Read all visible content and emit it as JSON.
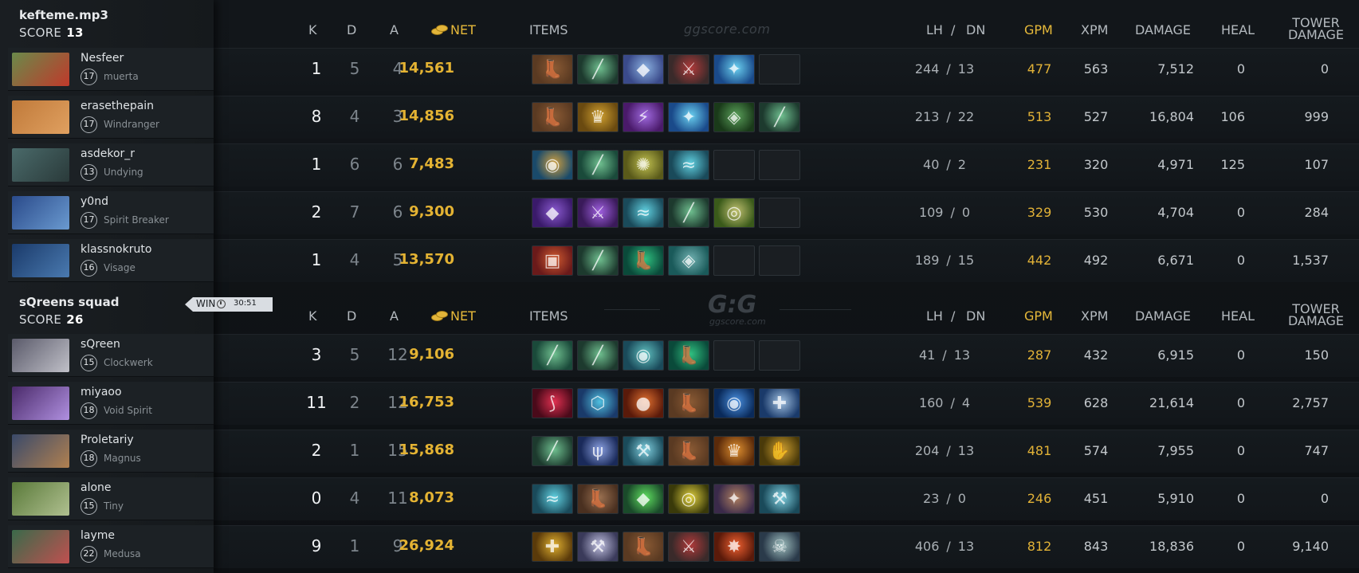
{
  "site": {
    "watermark": "ggscore.com",
    "logo": "G:G",
    "logo_sub": "ggscore.com"
  },
  "headers": {
    "k": "K",
    "d": "D",
    "a": "A",
    "net": "NET",
    "items": "ITEMS",
    "lh": "LH",
    "slash": "/",
    "dn": "DN",
    "gpm": "GPM",
    "xpm": "XPM",
    "damage": "DAMAGE",
    "heal": "HEAL",
    "tower_line1": "TOWER",
    "tower_line2": "DAMAGE"
  },
  "colors": {
    "gold": "#e4b333",
    "win_tag_bg": "#d9dde2"
  },
  "result": {
    "label": "WIN",
    "time": "30:51",
    "clock_icon": "clock-icon"
  },
  "teams": [
    {
      "name": "kefteme.mp3",
      "score_label": "SCORE",
      "score": "13",
      "players": [
        {
          "name": "Nesfeer",
          "level": "17",
          "hero": "muerta",
          "k": "1",
          "d": "5",
          "a": "4",
          "net": "14,561",
          "lh": "244",
          "dn": "13",
          "gpm": "477",
          "xpm": "563",
          "damage": "7,512",
          "heal": "0",
          "tower": "0",
          "portrait_colors": [
            "#6a8a4a",
            "#c0392b"
          ],
          "items": [
            {
              "name": "boots-icon",
              "c1": "#5a3a22",
              "c2": "#8a5a34",
              "g": "👢"
            },
            {
              "name": "staff-icon",
              "c1": "#1d3a2e",
              "c2": "#6fbf8f",
              "g": "╱"
            },
            {
              "name": "mask-icon",
              "c1": "#3a4a8a",
              "c2": "#8ab0e0",
              "g": "◆"
            },
            {
              "name": "axe-icon",
              "c1": "#3a2a2a",
              "c2": "#b03a3a",
              "g": "⚔"
            },
            {
              "name": "orb-icon",
              "c1": "#1a4a8a",
              "c2": "#6ad0f0",
              "g": "✦"
            },
            {
              "name": "empty-slot",
              "empty": true
            }
          ]
        },
        {
          "name": "erasethepain",
          "level": "17",
          "hero": "Windranger",
          "k": "8",
          "d": "4",
          "a": "3",
          "net": "14,856",
          "lh": "213",
          "dn": "22",
          "gpm": "513",
          "xpm": "527",
          "damage": "16,804",
          "heal": "106",
          "tower": "999",
          "portrait_colors": [
            "#c07a3a",
            "#e0a060"
          ],
          "items": [
            {
              "name": "boots-icon",
              "c1": "#5a3a22",
              "c2": "#8a5a34",
              "g": "👢"
            },
            {
              "name": "helm-icon",
              "c1": "#6a4a10",
              "c2": "#d0a030",
              "g": "♛"
            },
            {
              "name": "blade-icon",
              "c1": "#4a1a6a",
              "c2": "#a06ae0",
              "g": "⚡"
            },
            {
              "name": "orb-icon",
              "c1": "#1a4a8a",
              "c2": "#6ad0f0",
              "g": "✦"
            },
            {
              "name": "cloak-icon",
              "c1": "#1a3a1a",
              "c2": "#5aa05a",
              "g": "◈"
            },
            {
              "name": "staff-icon",
              "c1": "#1d3a2e",
              "c2": "#6fbf8f",
              "g": "╱"
            }
          ]
        },
        {
          "name": "asdekor_r",
          "level": "13",
          "hero": "Undying",
          "k": "1",
          "d": "6",
          "a": "6",
          "net": "7,483",
          "lh": "40",
          "dn": "2",
          "gpm": "231",
          "xpm": "320",
          "damage": "4,971",
          "heal": "125",
          "tower": "107",
          "portrait_colors": [
            "#4a6a6a",
            "#2a3a3a"
          ],
          "items": [
            {
              "name": "vessel-icon",
              "c1": "#1a4a6a",
              "c2": "#d0a040",
              "g": "◉"
            },
            {
              "name": "wand-icon",
              "c1": "#1a4a3a",
              "c2": "#70c090",
              "g": "╱"
            },
            {
              "name": "gem-icon",
              "c1": "#5a5a1a",
              "c2": "#c0c050",
              "g": "✺"
            },
            {
              "name": "wind-icon",
              "c1": "#1a4a5a",
              "c2": "#60d0e0",
              "g": "≈"
            },
            {
              "name": "empty-slot",
              "empty": true
            },
            {
              "name": "empty-slot",
              "empty": true
            }
          ]
        },
        {
          "name": "y0nd",
          "level": "17",
          "hero": "Spirit Breaker",
          "k": "2",
          "d": "7",
          "a": "6",
          "net": "9,300",
          "lh": "109",
          "dn": "0",
          "gpm": "329",
          "xpm": "530",
          "damage": "4,704",
          "heal": "0",
          "tower": "284",
          "portrait_colors": [
            "#2a4a8a",
            "#6a9ad0"
          ],
          "items": [
            {
              "name": "cape-icon",
              "c1": "#3a1a6a",
              "c2": "#8a5ad0",
              "g": "◆"
            },
            {
              "name": "sword-icon",
              "c1": "#3a1a5a",
              "c2": "#a060e0",
              "g": "⚔"
            },
            {
              "name": "wind-icon",
              "c1": "#1a4a5a",
              "c2": "#60d0e0",
              "g": "≈"
            },
            {
              "name": "staff-icon",
              "c1": "#1d3a2e",
              "c2": "#6fbf8f",
              "g": "╱"
            },
            {
              "name": "shield-icon",
              "c1": "#3a5a1a",
              "c2": "#c0c070",
              "g": "◎"
            },
            {
              "name": "empty-slot",
              "empty": true
            }
          ]
        },
        {
          "name": "klassnokruto",
          "level": "16",
          "hero": "Visage",
          "k": "1",
          "d": "4",
          "a": "5",
          "net": "13,570",
          "lh": "189",
          "dn": "15",
          "gpm": "442",
          "xpm": "492",
          "damage": "6,671",
          "heal": "0",
          "tower": "1,537",
          "portrait_colors": [
            "#1a3a6a",
            "#4a7ab0"
          ],
          "items": [
            {
              "name": "armor-icon",
              "c1": "#6a1a1a",
              "c2": "#d05a30",
              "g": "▣"
            },
            {
              "name": "staff-icon",
              "c1": "#1d3a2e",
              "c2": "#6fbf8f",
              "g": "╱"
            },
            {
              "name": "boots-green-icon",
              "c1": "#0a4a3a",
              "c2": "#30c080",
              "g": "👢"
            },
            {
              "name": "robe-icon",
              "c1": "#1a5a5a",
              "c2": "#70b0b0",
              "g": "◈"
            },
            {
              "name": "empty-slot",
              "empty": true
            },
            {
              "name": "empty-slot",
              "empty": true
            }
          ]
        }
      ]
    },
    {
      "name": "sQreens squad",
      "score_label": "SCORE",
      "score": "26",
      "players": [
        {
          "name": "sQreen",
          "level": "15",
          "hero": "Clockwerk",
          "k": "3",
          "d": "5",
          "a": "12",
          "net": "9,106",
          "lh": "41",
          "dn": "13",
          "gpm": "287",
          "xpm": "432",
          "damage": "6,915",
          "heal": "0",
          "tower": "150",
          "portrait_colors": [
            "#5a5a6a",
            "#c0c0c8"
          ],
          "items": [
            {
              "name": "wand-icon",
              "c1": "#1a4a3a",
              "c2": "#70c090",
              "g": "╱"
            },
            {
              "name": "staff-icon",
              "c1": "#1d3a2e",
              "c2": "#6fbf8f",
              "g": "╱"
            },
            {
              "name": "eye-icon",
              "c1": "#1a4a5a",
              "c2": "#60c0c0",
              "g": "◉"
            },
            {
              "name": "boots-green-icon",
              "c1": "#0a4a3a",
              "c2": "#30c080",
              "g": "👢"
            },
            {
              "name": "empty-slot",
              "empty": true
            },
            {
              "name": "empty-slot",
              "empty": true
            }
          ]
        },
        {
          "name": "miyaoo",
          "level": "18",
          "hero": "Void Spirit",
          "k": "11",
          "d": "2",
          "a": "12",
          "net": "16,753",
          "lh": "160",
          "dn": "4",
          "gpm": "539",
          "xpm": "628",
          "damage": "21,614",
          "heal": "0",
          "tower": "2,757",
          "portrait_colors": [
            "#4a2a6a",
            "#b090e0"
          ],
          "items": [
            {
              "name": "claw-icon",
              "c1": "#4a0a1a",
              "c2": "#e03050",
              "g": "⟆"
            },
            {
              "name": "bottle-icon",
              "c1": "#1a3a6a",
              "c2": "#50c0e0",
              "g": "⬡"
            },
            {
              "name": "fire-orb-icon",
              "c1": "#5a1a0a",
              "c2": "#e07030",
              "g": "●"
            },
            {
              "name": "boots-icon",
              "c1": "#5a3a22",
              "c2": "#8a5a34",
              "g": "👢"
            },
            {
              "name": "globe-icon",
              "c1": "#0a2a5a",
              "c2": "#4a90e0",
              "g": "◉"
            },
            {
              "name": "scepter-icon",
              "c1": "#1a3a6a",
              "c2": "#a0c0e0",
              "g": "✚"
            }
          ]
        },
        {
          "name": "Proletariy",
          "level": "18",
          "hero": "Magnus",
          "k": "2",
          "d": "1",
          "a": "15",
          "net": "15,868",
          "lh": "204",
          "dn": "13",
          "gpm": "481",
          "xpm": "574",
          "damage": "7,955",
          "heal": "0",
          "tower": "747",
          "portrait_colors": [
            "#3a4a6a",
            "#b08050"
          ],
          "items": [
            {
              "name": "staff-icon",
              "c1": "#1d3a2e",
              "c2": "#6fbf8f",
              "g": "╱"
            },
            {
              "name": "trident-icon",
              "c1": "#1a2a5a",
              "c2": "#8aa0e0",
              "g": "ψ"
            },
            {
              "name": "axe-blue-icon",
              "c1": "#1a4a5a",
              "c2": "#80d0e0",
              "g": "⚒"
            },
            {
              "name": "boots-icon",
              "c1": "#5a3a22",
              "c2": "#8a5a34",
              "g": "👢"
            },
            {
              "name": "helm-orange-icon",
              "c1": "#5a2a0a",
              "c2": "#e09030",
              "g": "♛"
            },
            {
              "name": "claw-gold-icon",
              "c1": "#4a3a0a",
              "c2": "#d0a030",
              "g": "✋"
            }
          ]
        },
        {
          "name": "alone",
          "level": "15",
          "hero": "Tiny",
          "k": "0",
          "d": "4",
          "a": "11",
          "net": "8,073",
          "lh": "23",
          "dn": "0",
          "gpm": "246",
          "xpm": "451",
          "damage": "5,910",
          "heal": "0",
          "tower": "0",
          "portrait_colors": [
            "#5a7a3a",
            "#b0c090"
          ],
          "items": [
            {
              "name": "wind-icon",
              "c1": "#1a4a5a",
              "c2": "#60d0e0",
              "g": "≈"
            },
            {
              "name": "boots-brown-icon",
              "c1": "#4a3020",
              "c2": "#9a7050",
              "g": "👢"
            },
            {
              "name": "gem-green-icon",
              "c1": "#1a4a2a",
              "c2": "#60e060",
              "g": "◆"
            },
            {
              "name": "ring-icon",
              "c1": "#3a3a0a",
              "c2": "#e0d040",
              "g": "◎"
            },
            {
              "name": "scroll-icon",
              "c1": "#3a2a4a",
              "c2": "#b08060",
              "g": "✦"
            },
            {
              "name": "axe-blue-icon",
              "c1": "#1a4a5a",
              "c2": "#80d0e0",
              "g": "⚒"
            }
          ]
        },
        {
          "name": "layme",
          "level": "22",
          "hero": "Medusa",
          "k": "9",
          "d": "1",
          "a": "9",
          "net": "26,924",
          "lh": "406",
          "dn": "13",
          "gpm": "812",
          "xpm": "843",
          "damage": "18,836",
          "heal": "0",
          "tower": "9,140",
          "portrait_colors": [
            "#3a6a4a",
            "#c05050"
          ],
          "items": [
            {
              "name": "scepter-gold-icon",
              "c1": "#5a3a0a",
              "c2": "#e0b030",
              "g": "✚"
            },
            {
              "name": "axe-silver-icon",
              "c1": "#3a3a5a",
              "c2": "#c0c0e0",
              "g": "⚒"
            },
            {
              "name": "boots-icon",
              "c1": "#5a3a22",
              "c2": "#8a5a34",
              "g": "👢"
            },
            {
              "name": "axe-icon",
              "c1": "#3a2a2a",
              "c2": "#b03a3a",
              "g": "⚔"
            },
            {
              "name": "burst-icon",
              "c1": "#5a1a0a",
              "c2": "#f06030",
              "g": "✸"
            },
            {
              "name": "skull-icon",
              "c1": "#2a3a4a",
              "c2": "#a0c0c0",
              "g": "☠"
            }
          ]
        }
      ]
    }
  ]
}
